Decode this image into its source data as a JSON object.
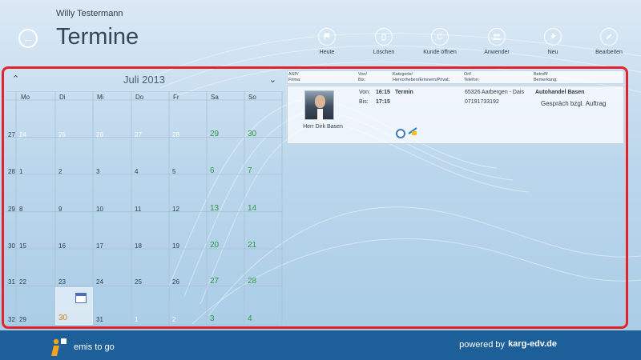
{
  "user": {
    "name": "Willy Testermann"
  },
  "page": {
    "title": "Termine"
  },
  "appbar": [
    {
      "label": "Heute",
      "icon": "flag-icon"
    },
    {
      "label": "Löschen",
      "icon": "trash-icon"
    },
    {
      "label": "Kunde öffnen",
      "icon": "refresh-icon"
    },
    {
      "label": "Anwender",
      "icon": "users-icon"
    },
    {
      "label": "Neu",
      "icon": "pin-icon"
    },
    {
      "label": "Bearbeiten",
      "icon": "pencil-icon"
    }
  ],
  "calendar": {
    "month": "Juli 2013",
    "weekdays": [
      "Mo",
      "Di",
      "Mi",
      "Do",
      "Fr",
      "Sa",
      "So"
    ],
    "weeks": [
      {
        "number": "27",
        "days": [
          "24",
          "25",
          "26",
          "27",
          "28",
          "29",
          "30"
        ]
      },
      {
        "number": "28",
        "days": [
          "1",
          "2",
          "3",
          "4",
          "5",
          "6",
          "7"
        ]
      },
      {
        "number": "29",
        "days": [
          "8",
          "9",
          "10",
          "11",
          "12",
          "13",
          "14"
        ]
      },
      {
        "number": "30",
        "days": [
          "15",
          "16",
          "17",
          "18",
          "19",
          "20",
          "21"
        ]
      },
      {
        "number": "31",
        "days": [
          "22",
          "23",
          "24",
          "25",
          "26",
          "27",
          "28"
        ]
      },
      {
        "number": "32",
        "days": [
          "29",
          "30",
          "31",
          "1",
          "2",
          "3",
          "4"
        ]
      }
    ],
    "today": "30"
  },
  "appointments": {
    "headers": {
      "asp": "ASP/",
      "firma": "Firma:",
      "von": "Von/",
      "bis": "Bis:",
      "kategorie": "Kategorie/",
      "hervorheben": "Hervorheben/Erinnern/Privat:",
      "ort": "Ort/",
      "telefon": "Telefon:",
      "betreff": "Betreff/",
      "bemerkung": "Bemerkung:"
    },
    "rows": [
      {
        "contact": "Herr Dirk Basen",
        "von_label": "Von:",
        "von": "16:15",
        "bis_label": "Bis:",
        "bis": "17:15",
        "category": "Termin",
        "location": "65326 Aarbergen - Dais",
        "phone": "07191733192",
        "company": "Autohandel Basen",
        "subject": "Gespräch bzgl. Auftrag"
      }
    ]
  },
  "footer": {
    "logo": "emis to go",
    "powered_prefix": "powered by",
    "powered_brand": "karg-edv.de"
  },
  "colors": {
    "accent_red": "#e2232b",
    "weekend_green": "#2e9a44",
    "today_orange": "#d0802a",
    "footer_blue": "#1d5f99"
  }
}
